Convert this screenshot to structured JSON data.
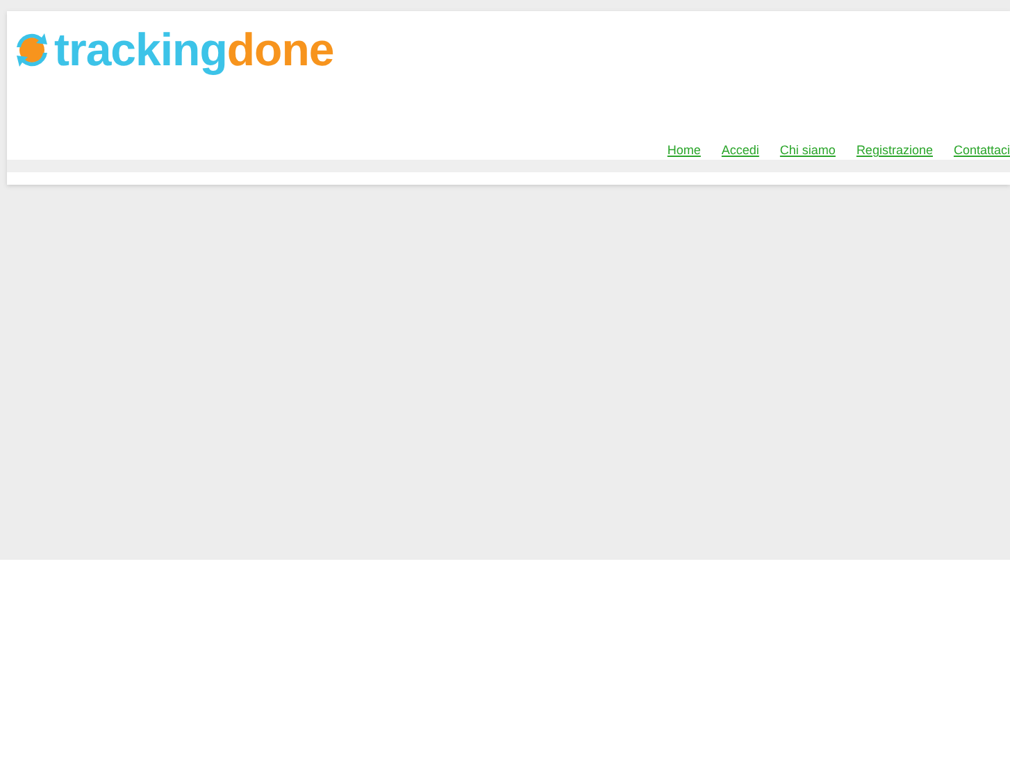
{
  "logo": {
    "parts": [
      {
        "text": "tracking",
        "color": "#3cc3e8"
      },
      {
        "text": "done",
        "color": "#f7941d"
      }
    ]
  },
  "nav": [
    {
      "label": "Home"
    },
    {
      "label": "Accedi"
    },
    {
      "label": "Chi siamo"
    },
    {
      "label": "Registrazione"
    },
    {
      "label": "Contattaci"
    }
  ]
}
